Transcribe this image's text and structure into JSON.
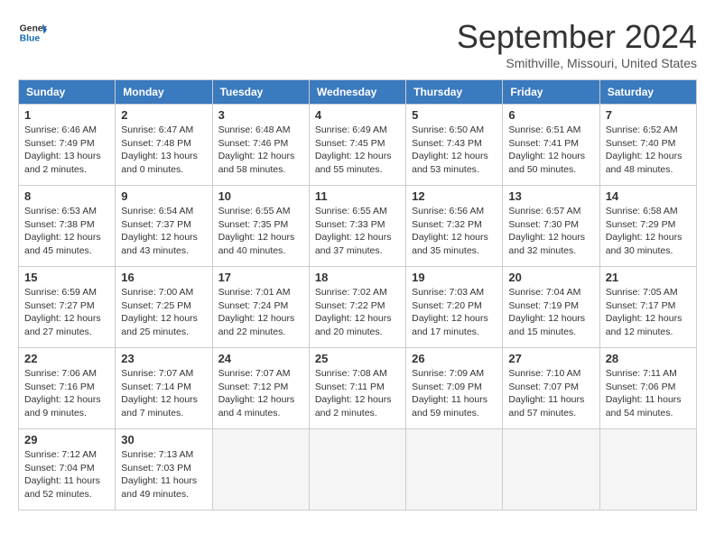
{
  "header": {
    "logo_line1": "General",
    "logo_line2": "Blue",
    "month": "September 2024",
    "location": "Smithville, Missouri, United States"
  },
  "weekdays": [
    "Sunday",
    "Monday",
    "Tuesday",
    "Wednesday",
    "Thursday",
    "Friday",
    "Saturday"
  ],
  "weeks": [
    [
      {
        "day": "1",
        "info": "Sunrise: 6:46 AM\nSunset: 7:49 PM\nDaylight: 13 hours\nand 2 minutes."
      },
      {
        "day": "2",
        "info": "Sunrise: 6:47 AM\nSunset: 7:48 PM\nDaylight: 13 hours\nand 0 minutes."
      },
      {
        "day": "3",
        "info": "Sunrise: 6:48 AM\nSunset: 7:46 PM\nDaylight: 12 hours\nand 58 minutes."
      },
      {
        "day": "4",
        "info": "Sunrise: 6:49 AM\nSunset: 7:45 PM\nDaylight: 12 hours\nand 55 minutes."
      },
      {
        "day": "5",
        "info": "Sunrise: 6:50 AM\nSunset: 7:43 PM\nDaylight: 12 hours\nand 53 minutes."
      },
      {
        "day": "6",
        "info": "Sunrise: 6:51 AM\nSunset: 7:41 PM\nDaylight: 12 hours\nand 50 minutes."
      },
      {
        "day": "7",
        "info": "Sunrise: 6:52 AM\nSunset: 7:40 PM\nDaylight: 12 hours\nand 48 minutes."
      }
    ],
    [
      {
        "day": "8",
        "info": "Sunrise: 6:53 AM\nSunset: 7:38 PM\nDaylight: 12 hours\nand 45 minutes."
      },
      {
        "day": "9",
        "info": "Sunrise: 6:54 AM\nSunset: 7:37 PM\nDaylight: 12 hours\nand 43 minutes."
      },
      {
        "day": "10",
        "info": "Sunrise: 6:55 AM\nSunset: 7:35 PM\nDaylight: 12 hours\nand 40 minutes."
      },
      {
        "day": "11",
        "info": "Sunrise: 6:55 AM\nSunset: 7:33 PM\nDaylight: 12 hours\nand 37 minutes."
      },
      {
        "day": "12",
        "info": "Sunrise: 6:56 AM\nSunset: 7:32 PM\nDaylight: 12 hours\nand 35 minutes."
      },
      {
        "day": "13",
        "info": "Sunrise: 6:57 AM\nSunset: 7:30 PM\nDaylight: 12 hours\nand 32 minutes."
      },
      {
        "day": "14",
        "info": "Sunrise: 6:58 AM\nSunset: 7:29 PM\nDaylight: 12 hours\nand 30 minutes."
      }
    ],
    [
      {
        "day": "15",
        "info": "Sunrise: 6:59 AM\nSunset: 7:27 PM\nDaylight: 12 hours\nand 27 minutes."
      },
      {
        "day": "16",
        "info": "Sunrise: 7:00 AM\nSunset: 7:25 PM\nDaylight: 12 hours\nand 25 minutes."
      },
      {
        "day": "17",
        "info": "Sunrise: 7:01 AM\nSunset: 7:24 PM\nDaylight: 12 hours\nand 22 minutes."
      },
      {
        "day": "18",
        "info": "Sunrise: 7:02 AM\nSunset: 7:22 PM\nDaylight: 12 hours\nand 20 minutes."
      },
      {
        "day": "19",
        "info": "Sunrise: 7:03 AM\nSunset: 7:20 PM\nDaylight: 12 hours\nand 17 minutes."
      },
      {
        "day": "20",
        "info": "Sunrise: 7:04 AM\nSunset: 7:19 PM\nDaylight: 12 hours\nand 15 minutes."
      },
      {
        "day": "21",
        "info": "Sunrise: 7:05 AM\nSunset: 7:17 PM\nDaylight: 12 hours\nand 12 minutes."
      }
    ],
    [
      {
        "day": "22",
        "info": "Sunrise: 7:06 AM\nSunset: 7:16 PM\nDaylight: 12 hours\nand 9 minutes."
      },
      {
        "day": "23",
        "info": "Sunrise: 7:07 AM\nSunset: 7:14 PM\nDaylight: 12 hours\nand 7 minutes."
      },
      {
        "day": "24",
        "info": "Sunrise: 7:07 AM\nSunset: 7:12 PM\nDaylight: 12 hours\nand 4 minutes."
      },
      {
        "day": "25",
        "info": "Sunrise: 7:08 AM\nSunset: 7:11 PM\nDaylight: 12 hours\nand 2 minutes."
      },
      {
        "day": "26",
        "info": "Sunrise: 7:09 AM\nSunset: 7:09 PM\nDaylight: 11 hours\nand 59 minutes."
      },
      {
        "day": "27",
        "info": "Sunrise: 7:10 AM\nSunset: 7:07 PM\nDaylight: 11 hours\nand 57 minutes."
      },
      {
        "day": "28",
        "info": "Sunrise: 7:11 AM\nSunset: 7:06 PM\nDaylight: 11 hours\nand 54 minutes."
      }
    ],
    [
      {
        "day": "29",
        "info": "Sunrise: 7:12 AM\nSunset: 7:04 PM\nDaylight: 11 hours\nand 52 minutes."
      },
      {
        "day": "30",
        "info": "Sunrise: 7:13 AM\nSunset: 7:03 PM\nDaylight: 11 hours\nand 49 minutes."
      },
      null,
      null,
      null,
      null,
      null
    ]
  ]
}
